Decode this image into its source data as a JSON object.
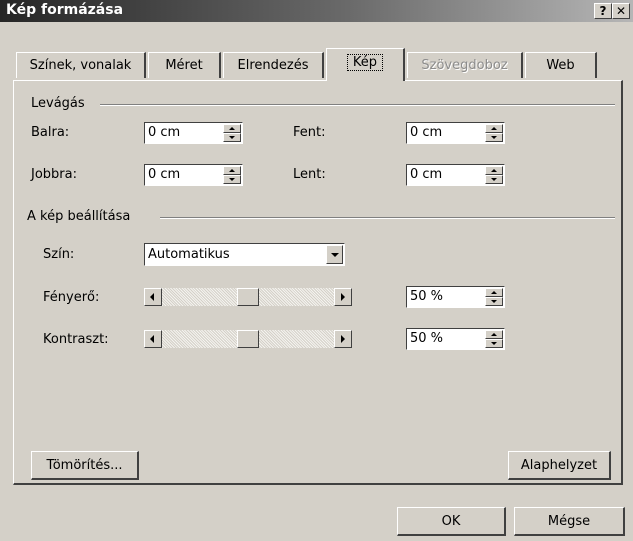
{
  "title": "Kép formázása",
  "title_buttons": {
    "help": "?",
    "close": "✕"
  },
  "tabs": [
    {
      "label": "Színek, vonalak"
    },
    {
      "label": "Méret"
    },
    {
      "label": "Elrendezés"
    },
    {
      "label": "Kép",
      "active": true
    },
    {
      "label": "Szövegdoboz",
      "disabled": true
    },
    {
      "label": "Web"
    }
  ],
  "crop": {
    "heading": "Levágás",
    "left": {
      "label": "Balra:",
      "value": "0 cm"
    },
    "right": {
      "label": "Jobbra:",
      "value": "0 cm"
    },
    "top": {
      "label": "Fent:",
      "value": "0 cm"
    },
    "bottom": {
      "label": "Lent:",
      "value": "0 cm"
    }
  },
  "image_control": {
    "heading": "A kép beállítása",
    "color": {
      "label": "Szín:",
      "value": "Automatikus"
    },
    "brightness": {
      "label": "Fényerő:",
      "value": "50 %",
      "level": 0.5
    },
    "contrast": {
      "label": "Kontraszt:",
      "value": "50 %",
      "level": 0.5
    }
  },
  "buttons": {
    "compress": "Tömörítés...",
    "reset": "Alaphelyzet",
    "ok": "OK",
    "cancel": "Mégse"
  },
  "icons": {
    "spin_up": "up-arrow-icon",
    "spin_down": "down-arrow-icon",
    "dropdown": "chevron-down-icon",
    "scroll_left": "left-arrow-icon",
    "scroll_right": "right-arrow-icon"
  }
}
